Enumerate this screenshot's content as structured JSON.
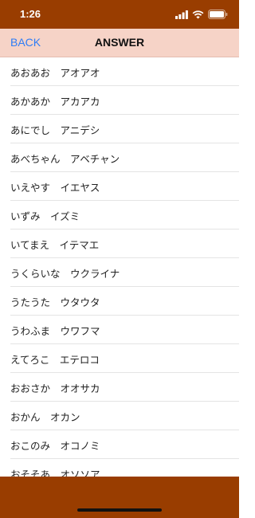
{
  "status": {
    "time": "1:26",
    "icons": [
      "signal-icon",
      "wifi-icon",
      "battery-icon"
    ]
  },
  "nav": {
    "back_label": "BACK",
    "title": "ANSWER"
  },
  "colors": {
    "frame": "#993d00",
    "nav_background": "#f6d3c7",
    "back_link": "#2f7df6"
  },
  "answers": [
    "あおあお　アオアオ",
    "あかあか　アカアカ",
    "あにでし　アニデシ",
    "あべちゃん　アベチャン",
    "いえやす　イエヤス",
    "いずみ　イズミ",
    "いてまえ　イテマエ",
    "うくらいな　ウクライナ",
    "うたうた　ウタウタ",
    "うわふま　ウワフマ",
    "えてろこ　エテロコ",
    "おおさか　オオサカ",
    "おかん　オカン",
    "おこのみ　オコノミ",
    "おそそあ　オソソア"
  ]
}
